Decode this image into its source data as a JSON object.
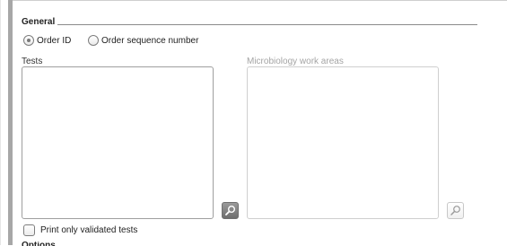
{
  "section": {
    "title": "General"
  },
  "sort_by": {
    "options": [
      "Order ID",
      "Order sequence number"
    ],
    "selected": "Order ID"
  },
  "tests": {
    "label": "Tests",
    "items": []
  },
  "work_areas": {
    "label": "Microbiology work areas",
    "items": [],
    "enabled": false
  },
  "print_validated": {
    "label": "Print only validated tests",
    "checked": false
  },
  "next_section": {
    "title": "Options"
  },
  "icons": {
    "tests_lookup": "magnifier-icon",
    "work_areas_lookup": "magnifier-icon"
  },
  "colors": {
    "accent_bar": "#a7a7a7",
    "active_button": "#7a7a7a",
    "disabled_text": "#a4a4a4"
  }
}
